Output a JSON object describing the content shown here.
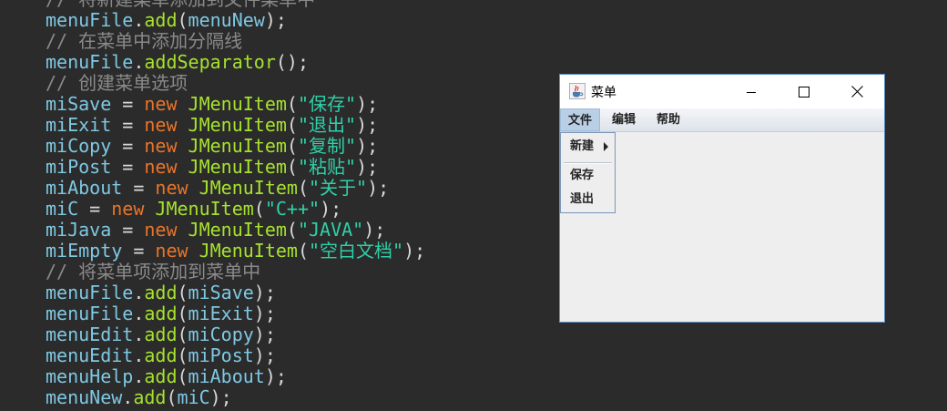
{
  "editor": {
    "lines": [
      [
        [
          "comment",
          "// 将新建菜单添加到文件菜单中"
        ]
      ],
      [
        [
          "ident",
          "menuFile"
        ],
        [
          "punct",
          "."
        ],
        [
          "method",
          "add"
        ],
        [
          "punct",
          "("
        ],
        [
          "ident",
          "menuNew"
        ],
        [
          "punct",
          ");"
        ]
      ],
      [
        [
          "comment",
          "// 在菜单中添加分隔线"
        ]
      ],
      [
        [
          "ident",
          "menuFile"
        ],
        [
          "punct",
          "."
        ],
        [
          "method",
          "addSeparator"
        ],
        [
          "punct",
          "();"
        ]
      ],
      [
        [
          "comment",
          "// 创建菜单选项"
        ]
      ],
      [
        [
          "ident",
          "miSave"
        ],
        [
          "punct",
          " = "
        ],
        [
          "kw",
          "new"
        ],
        [
          "punct",
          " "
        ],
        [
          "class",
          "JMenuItem"
        ],
        [
          "punct",
          "("
        ],
        [
          "str",
          "\"保存\""
        ],
        [
          "punct",
          ");"
        ]
      ],
      [
        [
          "ident",
          "miExit"
        ],
        [
          "punct",
          " = "
        ],
        [
          "kw",
          "new"
        ],
        [
          "punct",
          " "
        ],
        [
          "class",
          "JMenuItem"
        ],
        [
          "punct",
          "("
        ],
        [
          "str",
          "\"退出\""
        ],
        [
          "punct",
          ");"
        ]
      ],
      [
        [
          "ident",
          "miCopy"
        ],
        [
          "punct",
          " = "
        ],
        [
          "kw",
          "new"
        ],
        [
          "punct",
          " "
        ],
        [
          "class",
          "JMenuItem"
        ],
        [
          "punct",
          "("
        ],
        [
          "str",
          "\"复制\""
        ],
        [
          "punct",
          ");"
        ]
      ],
      [
        [
          "ident",
          "miPost"
        ],
        [
          "punct",
          " = "
        ],
        [
          "kw",
          "new"
        ],
        [
          "punct",
          " "
        ],
        [
          "class",
          "JMenuItem"
        ],
        [
          "punct",
          "("
        ],
        [
          "str",
          "\"粘贴\""
        ],
        [
          "punct",
          ");"
        ]
      ],
      [
        [
          "ident",
          "miAbout"
        ],
        [
          "punct",
          " = "
        ],
        [
          "kw",
          "new"
        ],
        [
          "punct",
          " "
        ],
        [
          "class",
          "JMenuItem"
        ],
        [
          "punct",
          "("
        ],
        [
          "str",
          "\"关于\""
        ],
        [
          "punct",
          ");"
        ]
      ],
      [
        [
          "ident",
          "miC"
        ],
        [
          "punct",
          " = "
        ],
        [
          "kw",
          "new"
        ],
        [
          "punct",
          " "
        ],
        [
          "class",
          "JMenuItem"
        ],
        [
          "punct",
          "("
        ],
        [
          "str",
          "\"C++\""
        ],
        [
          "punct",
          ");"
        ]
      ],
      [
        [
          "ident",
          "miJava"
        ],
        [
          "punct",
          " = "
        ],
        [
          "kw",
          "new"
        ],
        [
          "punct",
          " "
        ],
        [
          "class",
          "JMenuItem"
        ],
        [
          "punct",
          "("
        ],
        [
          "str",
          "\"JAVA\""
        ],
        [
          "punct",
          ");"
        ]
      ],
      [
        [
          "ident",
          "miEmpty"
        ],
        [
          "punct",
          " = "
        ],
        [
          "kw",
          "new"
        ],
        [
          "punct",
          " "
        ],
        [
          "class",
          "JMenuItem"
        ],
        [
          "punct",
          "("
        ],
        [
          "str",
          "\"空白文档\""
        ],
        [
          "punct",
          ");"
        ]
      ],
      [
        [
          "comment",
          "// 将菜单项添加到菜单中"
        ]
      ],
      [
        [
          "ident",
          "menuFile"
        ],
        [
          "punct",
          "."
        ],
        [
          "method",
          "add"
        ],
        [
          "punct",
          "("
        ],
        [
          "ident",
          "miSave"
        ],
        [
          "punct",
          ");"
        ]
      ],
      [
        [
          "ident",
          "menuFile"
        ],
        [
          "punct",
          "."
        ],
        [
          "method",
          "add"
        ],
        [
          "punct",
          "("
        ],
        [
          "ident",
          "miExit"
        ],
        [
          "punct",
          ");"
        ]
      ],
      [
        [
          "ident",
          "menuEdit"
        ],
        [
          "punct",
          "."
        ],
        [
          "method",
          "add"
        ],
        [
          "punct",
          "("
        ],
        [
          "ident",
          "miCopy"
        ],
        [
          "punct",
          ");"
        ]
      ],
      [
        [
          "ident",
          "menuEdit"
        ],
        [
          "punct",
          "."
        ],
        [
          "method",
          "add"
        ],
        [
          "punct",
          "("
        ],
        [
          "ident",
          "miPost"
        ],
        [
          "punct",
          ");"
        ]
      ],
      [
        [
          "ident",
          "menuHelp"
        ],
        [
          "punct",
          "."
        ],
        [
          "method",
          "add"
        ],
        [
          "punct",
          "("
        ],
        [
          "ident",
          "miAbout"
        ],
        [
          "punct",
          ");"
        ]
      ],
      [
        [
          "ident",
          "menuNew"
        ],
        [
          "punct",
          "."
        ],
        [
          "method",
          "add"
        ],
        [
          "punct",
          "("
        ],
        [
          "ident",
          "miC"
        ],
        [
          "punct",
          ");"
        ]
      ]
    ]
  },
  "window": {
    "title": "菜单",
    "icon": "java-coffee-icon",
    "controls": {
      "minimize": "minimize-icon",
      "maximize": "maximize-icon",
      "close": "close-icon"
    },
    "menus": [
      {
        "label": "文件"
      },
      {
        "label": "编辑"
      },
      {
        "label": "帮助"
      }
    ],
    "popup": {
      "items": [
        {
          "label": "新建"
        },
        {
          "label": "保存"
        },
        {
          "label": "退出"
        }
      ]
    },
    "colors": {
      "active_menu": "#b8cfe5",
      "border": "#5f8fc4"
    }
  }
}
